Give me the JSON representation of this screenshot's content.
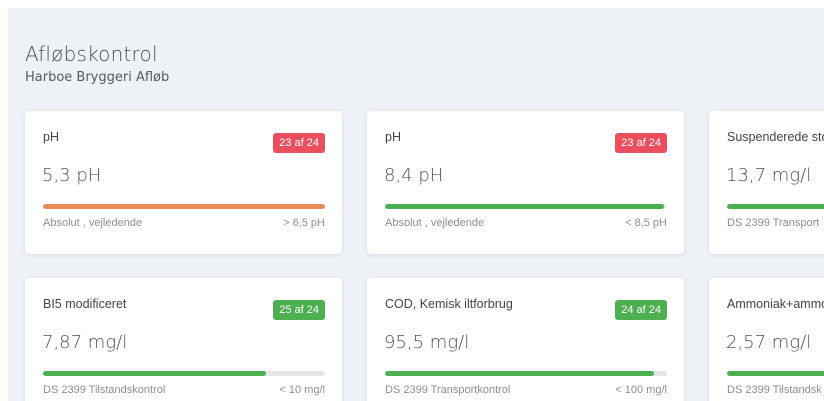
{
  "header": {
    "title": "Afløbskontrol",
    "subtitle": "Harboe Bryggeri Afløb"
  },
  "cards": [
    {
      "label": "pH",
      "badge": "23 af 24",
      "badge_status": "red",
      "value": "5,3 pH",
      "bar_fraction": 1.0,
      "bar_color": "#ec8a5a",
      "foot_left": "Absolut , vejledende",
      "foot_right": "> 6,5 pH"
    },
    {
      "label": "pH",
      "badge": "23 af 24",
      "badge_status": "red",
      "value": "8,4 pH",
      "bar_fraction": 0.99,
      "bar_color": "#4caf50",
      "foot_left": "Absolut , vejledende",
      "foot_right": "< 8,5 pH"
    },
    {
      "label": "Suspenderede sto",
      "badge": "",
      "badge_status": "",
      "value": "13,7 mg/l",
      "bar_fraction": 1.0,
      "bar_color": "#4caf50",
      "foot_left": "DS 2399 Transport",
      "foot_right": ""
    },
    {
      "label": "BI5 modificeret",
      "badge": "25 af 24",
      "badge_status": "green",
      "value": "7,87 mg/l",
      "bar_fraction": 0.79,
      "bar_color": "#4caf50",
      "foot_left": "DS 2399 Tilstandskontrol",
      "foot_right": "< 10 mg/l"
    },
    {
      "label": "COD, Kemisk iltforbrug",
      "badge": "24 af 24",
      "badge_status": "green",
      "value": "95,5 mg/l",
      "bar_fraction": 0.955,
      "bar_color": "#4caf50",
      "foot_left": "DS 2399 Transportkontrol",
      "foot_right": "< 100 mg/l"
    },
    {
      "label": "Ammoniak+ammo",
      "badge": "",
      "badge_status": "",
      "value": "2,57 mg/l",
      "bar_fraction": 1.0,
      "bar_color": "#4caf50",
      "foot_left": "DS 2399 Tilstandsk",
      "foot_right": ""
    }
  ]
}
